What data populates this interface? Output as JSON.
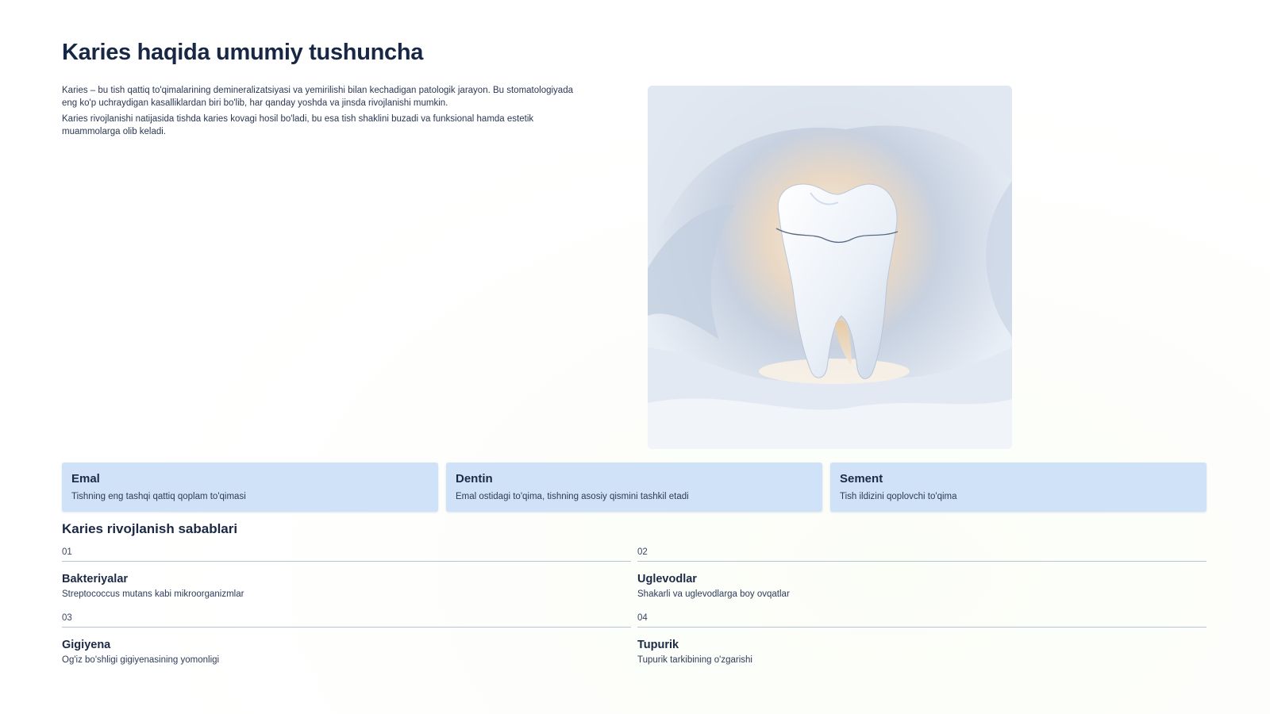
{
  "slide": {
    "title": "Karies haqida umumiy tushuncha",
    "intro": [
      "Karies – bu tish qattiq to'qimalarining demineralizatsiyasi va yemirilishi bilan kechadigan patologik jarayon. Bu stomatologiyada eng ko'p uchraydigan kasalliklardan biri bo'lib, har qanday yoshda va jinsda rivojlanishi mumkin.",
      "Karies rivojlanishi natijasida tishda karies kovagi hosil bo'ladi, bu esa tish shaklini buzadi va funksional hamda estetik muammolarga olib keladi."
    ],
    "image": {
      "icon": "tooth-illustration"
    },
    "layers": [
      {
        "title": "Emal",
        "description": "Tishning eng tashqi qattiq qoplam to'qimasi"
      },
      {
        "title": "Dentin",
        "description": "Emal ostidagi to'qima, tishning asosiy qismini tashkil etadi"
      },
      {
        "title": "Sement",
        "description": "Tish ildizini qoplovchi to'qima"
      }
    ],
    "causes_title": "Karies rivojlanish sabablari",
    "causes": [
      {
        "number": "01",
        "title": "Bakteriyalar",
        "description": "Streptococcus mutans kabi mikroorganizmlar"
      },
      {
        "number": "02",
        "title": "Uglevodlar",
        "description": "Shakarli va uglevodlarga boy ovqatlar"
      },
      {
        "number": "03",
        "title": "Gigiyena",
        "description": "Og'iz bo'shligi gigiyenasining yomonligi"
      },
      {
        "number": "04",
        "title": "Tupurik",
        "description": "Tupurik tarkibining o'zgarishi"
      }
    ],
    "colors": {
      "title": "#182744",
      "card_background": "#cfe2f8",
      "rule": "#b8c3d3"
    }
  }
}
